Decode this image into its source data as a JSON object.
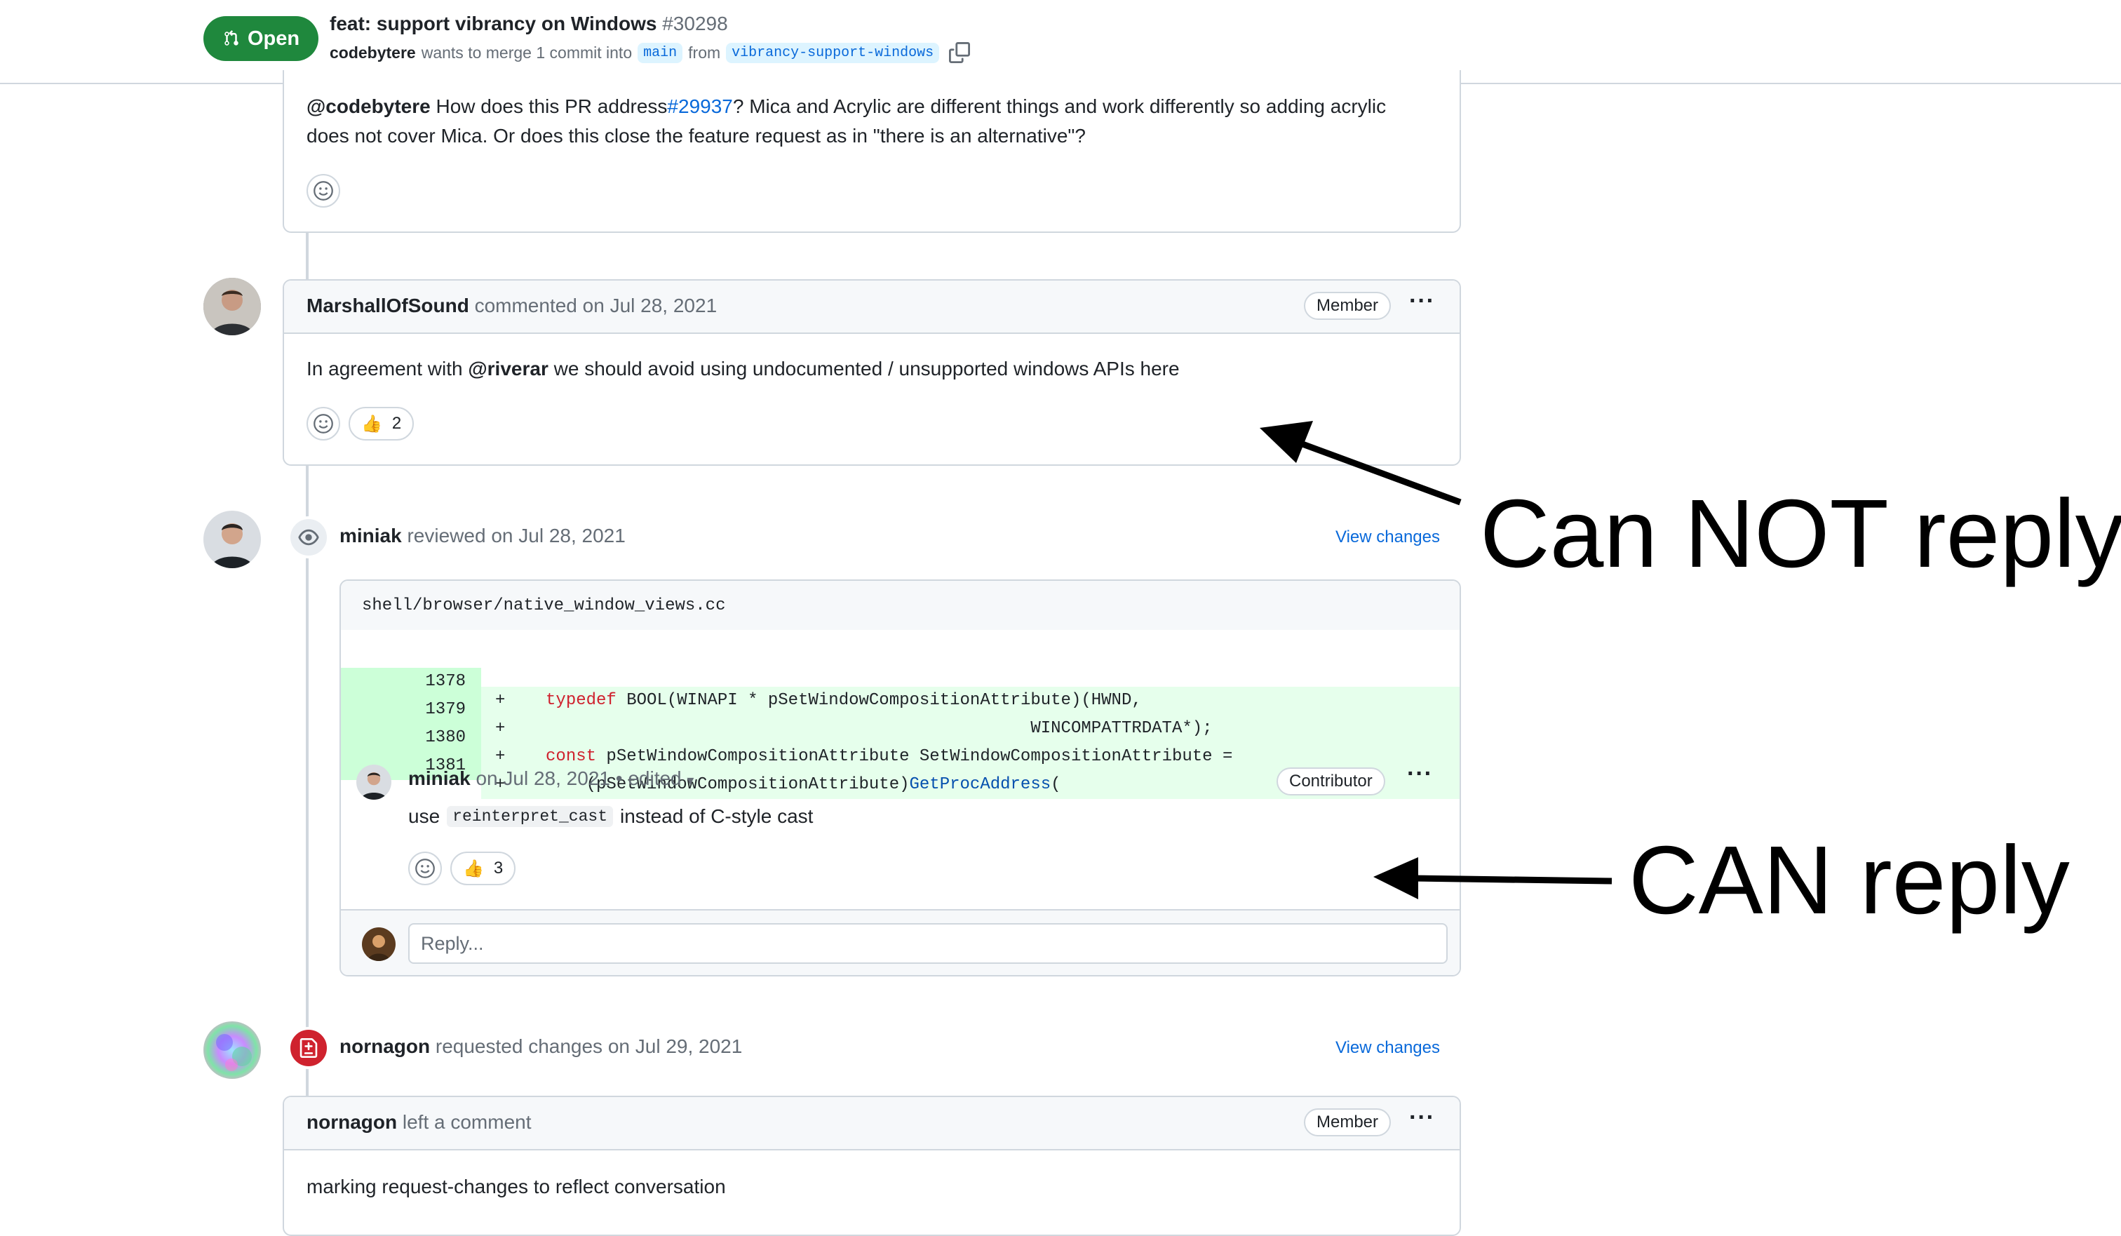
{
  "header": {
    "state": "Open",
    "title": "feat: support vibrancy on Windows",
    "number": "#30298",
    "author": "codebytere",
    "merge_text": "wants to merge 1 commit into",
    "base_branch": "main",
    "from_text": "from",
    "head_branch": "vibrancy-support-windows"
  },
  "comment1": {
    "mention": "@codebytere",
    "text_a": "How does this PR address",
    "issue_link": "#29937",
    "text_b": "? Mica and Acrylic are different things and work differently so adding acrylic",
    "line2": "does not cover Mica. Or does this close the feature request as in \"there is an alternative\"?"
  },
  "comment2": {
    "author": "MarshallOfSound",
    "meta": "commented on Jul 28, 2021",
    "role": "Member",
    "text_a": "In agreement with",
    "mention": "@riverar",
    "text_b": "we should avoid using undocumented / unsupported windows APIs here",
    "reaction_count": "2"
  },
  "review1": {
    "author": "miniak",
    "meta": "reviewed on Jul 28, 2021",
    "view_changes": "View changes",
    "file": "shell/browser/native_window_views.cc",
    "diff": [
      {
        "line": "1378",
        "sign": "+",
        "kw": "typedef",
        "code": " BOOL(WINAPI * pSetWindowCompositionAttribute)(HWND,",
        "fn": "",
        "tail": "",
        "indent": "    "
      },
      {
        "line": "1379",
        "sign": "+",
        "kw": "",
        "code": "WINCOMPATTRDATA*);",
        "fn": "",
        "tail": "",
        "indent": "                                                    "
      },
      {
        "line": "1380",
        "sign": "+",
        "kw": "const",
        "code": " pSetWindowCompositionAttribute SetWindowCompositionAttribute =",
        "fn": "",
        "tail": "",
        "indent": "    "
      },
      {
        "line": "1381",
        "sign": "+",
        "kw": "",
        "code": "(pSetWindowCompositionAttribute)",
        "fn": "GetProcAddress",
        "tail": "(",
        "indent": "        "
      }
    ],
    "comment_author": "miniak",
    "comment_meta": "on Jul 28, 2021 • edited",
    "role": "Contributor",
    "comment_text_a": "use",
    "comment_code": "reinterpret_cast",
    "comment_text_b": "instead of C-style cast",
    "reaction_count": "3",
    "reply_placeholder": "Reply..."
  },
  "review2": {
    "author": "nornagon",
    "meta": "requested changes on Jul 29, 2021",
    "view_changes": "View changes",
    "comment_author": "nornagon",
    "comment_meta": "left a comment",
    "role": "Member",
    "comment_text": "marking request-changes to reflect conversation"
  },
  "annotations": {
    "cannot": "Can NOT reply",
    "can": "CAN reply"
  },
  "colors": {
    "open_green": "#1f883d",
    "link_blue": "#0969da",
    "diff_add": "#e6ffec",
    "request_changes_red": "#cf222e"
  }
}
